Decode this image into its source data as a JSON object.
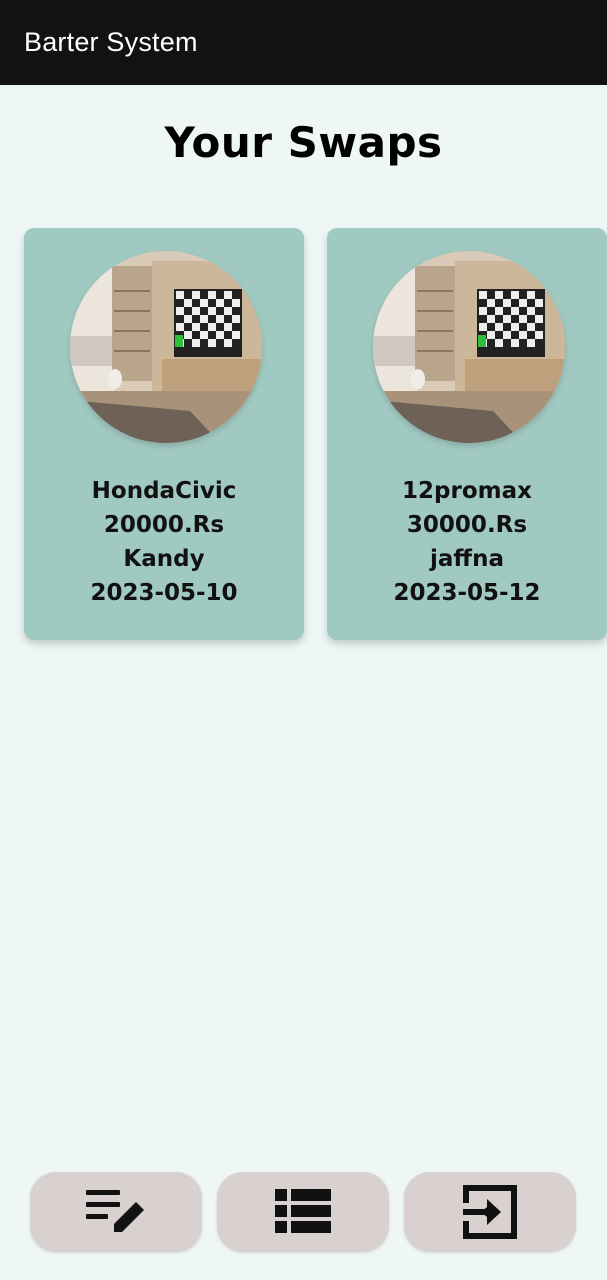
{
  "appbar": {
    "title": "Barter System"
  },
  "page": {
    "title": "Your Swaps"
  },
  "swaps": [
    {
      "name": "HondaCivic",
      "price": "20000.Rs",
      "location": "Kandy",
      "date": "2023-05-10",
      "image_icon": "living-room-tv-photo"
    },
    {
      "name": "12promax",
      "price": "30000.Rs",
      "location": "jaffna",
      "date": "2023-05-12",
      "image_icon": "living-room-tv-photo"
    }
  ],
  "bottom_nav": [
    {
      "icon": "edit-list-icon"
    },
    {
      "icon": "list-view-icon"
    },
    {
      "icon": "logout-icon"
    }
  ],
  "colors": {
    "appbar": "#121212",
    "background": "#eef7f5",
    "card": "#a0c9c1",
    "nav_button": "#d8d1d0"
  }
}
